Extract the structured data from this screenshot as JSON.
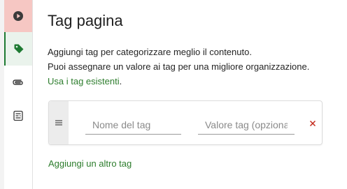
{
  "sidebar": {
    "items": [
      {
        "name": "play",
        "icon": "play-circle-icon"
      },
      {
        "name": "tag",
        "icon": "tag-icon"
      },
      {
        "name": "attachment",
        "icon": "paperclip-icon"
      },
      {
        "name": "form",
        "icon": "form-icon"
      }
    ]
  },
  "panel": {
    "title": "Tag pagina",
    "description_line1": "Aggiungi tag per categorizzare meglio il contenuto.",
    "description_line2": "Puoi assegnare un valore ai tag per una migliore organizzazione.",
    "existing_tags_link": "Usa i tag esistenti",
    "link_suffix": "."
  },
  "tag_row": {
    "name_placeholder": "Nome del tag",
    "value_placeholder": "Valore tag (opzionale)",
    "name_value": "",
    "value_value": ""
  },
  "add_tag_label": "Aggiungi un altro tag",
  "colors": {
    "accent": "#2d7d2d",
    "active_tab": "#1e7a32",
    "first_tab_bg": "#f6c7c3",
    "remove_icon": "#c42b1c"
  }
}
